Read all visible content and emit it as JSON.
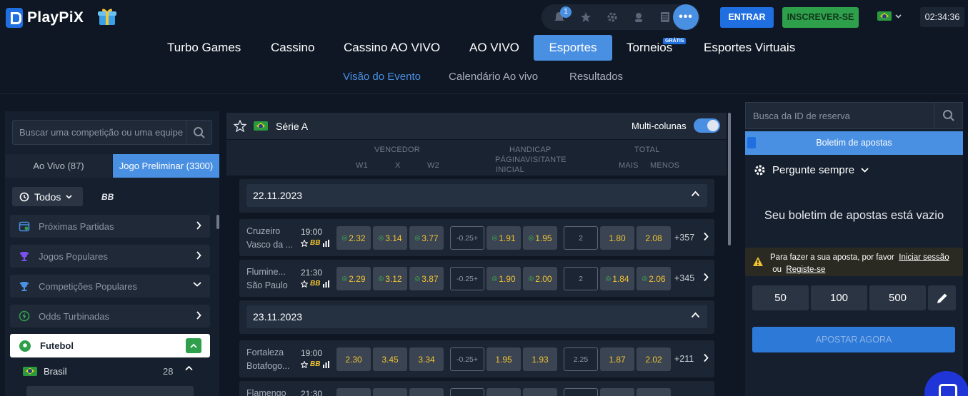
{
  "header": {
    "logo_text": "PlayPiX",
    "notif_count": "1",
    "login_label": "ENTRAR",
    "register_label": "INSCREVER-SE",
    "clock": "02:34:36",
    "more_label": "•••"
  },
  "main_nav": {
    "items": [
      "Turbo Games",
      "Cassino",
      "Cassino AO VIVO",
      "AO VIVO",
      "Esportes",
      "Torneios",
      "Esportes Virtuais"
    ],
    "active": "Esportes",
    "torneios_badge": "GRÁTIS"
  },
  "sub_nav": {
    "items": [
      "Visão do Evento",
      "Calendário Ao vivo",
      "Resultados"
    ],
    "active": "Visão do Evento"
  },
  "left": {
    "search_placeholder": "Buscar uma competição ou uma equipe",
    "tab_live": "Ao Vivo (87)",
    "tab_pre": "Jogo Preliminar (3300)",
    "filter_all": "Todos",
    "bb_label": "BB",
    "menu": [
      {
        "label": "Próximas Partidas",
        "icon": "calendar-icon",
        "chevron": "right"
      },
      {
        "label": "Jogos Populares",
        "icon": "trophy-icon",
        "chevron": "right"
      },
      {
        "label": "Competições Populares",
        "icon": "trophy-icon",
        "chevron": "down"
      },
      {
        "label": "Odds Turbinadas",
        "icon": "boost-icon",
        "chevron": "right"
      }
    ],
    "sport": "Futebol",
    "country": "Brasil",
    "country_count": "28"
  },
  "center": {
    "league": "Série A",
    "multi_label": "Multi-colunas",
    "headers": {
      "vencedor": "VENCEDOR",
      "w1": "W1",
      "x": "X",
      "w2": "W2",
      "handicap_title": "HANDICAP",
      "handicap_sub1": "PÁGINAVISITANTE",
      "handicap_sub2": "INICIAL",
      "total": "TOTAL",
      "mais": "MAIS",
      "menos": "MENOS"
    },
    "dates": [
      "22.11.2023",
      "23.11.2023"
    ],
    "matches": [
      {
        "home": "Cruzeiro",
        "away": "Vasco da ...",
        "time": "19:00",
        "w1": "2.32",
        "x": "3.14",
        "w2": "3.77",
        "hcp": "-0.25+",
        "h1": "1.91",
        "h2": "1.95",
        "total": "2",
        "over": "1.80",
        "under": "2.08",
        "more": "+357"
      },
      {
        "home": "Flumine...",
        "away": "São Paulo",
        "time": "21:30",
        "w1": "2.29",
        "x": "3.12",
        "w2": "3.87",
        "hcp": "-0.25+",
        "h1": "1.90",
        "h2": "2.00",
        "total": "2",
        "over": "1.84",
        "under": "2.06",
        "more": "+345"
      },
      {
        "home": "Fortaleza",
        "away": "Botafogo...",
        "time": "19:00",
        "w1": "2.30",
        "x": "3.45",
        "w2": "3.34",
        "hcp": "-0.25+",
        "h1": "1.95",
        "h2": "1.93",
        "total": "2.25",
        "over": "1.87",
        "under": "2.02",
        "more": "+211"
      },
      {
        "home": "Flamengo",
        "away": "",
        "time": "21:30"
      }
    ]
  },
  "right": {
    "search_placeholder": "Busca da ID de reserva",
    "betslip_title": "Boletim de apostas",
    "ask_label": "Pergunte sempre",
    "empty_msg": "Seu boletim de apostas está vazio",
    "warn_prefix": "Para fazer a sua aposta, por favor",
    "warn_login": "Iniciar sessão",
    "warn_or": "ou",
    "warn_register": "Registe-se",
    "stakes": [
      "50",
      "100",
      "500"
    ],
    "place_bet": "APOSTAR AGORA"
  },
  "colors": {
    "accent": "#4a90e2",
    "success": "#2e9f4a",
    "odd_text": "#f1c232",
    "background": "#0f1724"
  }
}
